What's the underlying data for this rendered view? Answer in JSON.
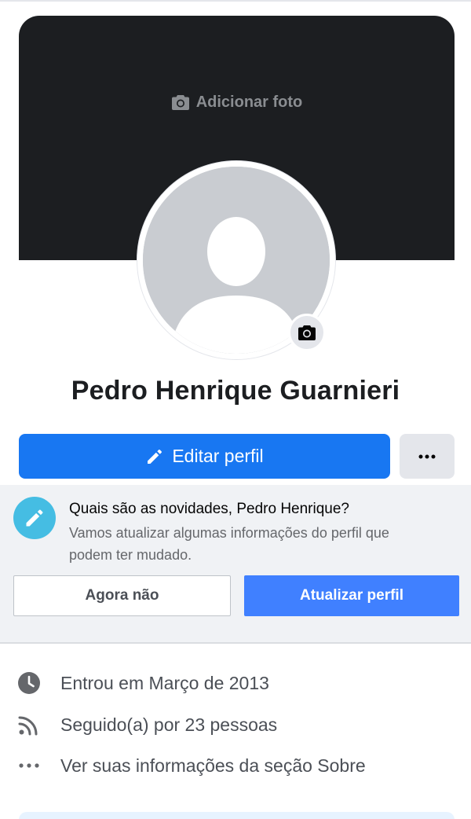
{
  "cover": {
    "add_photo_label": "Adicionar foto",
    "icons": [
      "camera-icon"
    ]
  },
  "profile": {
    "name": "Pedro Henrique Guarnieri"
  },
  "actions": {
    "edit_label": "Editar perfil",
    "edit_icon": "pencil-icon",
    "more_icon": "more-horizontal-icon"
  },
  "update_prompt": {
    "title": "Quais são as novidades, Pedro Henrique?",
    "description": "Vamos atualizar algumas informações do perfil que podem ter mudado.",
    "later_label": "Agora não",
    "update_label": "Atualizar perfil",
    "icon": "pencil-icon"
  },
  "intro": {
    "items": [
      {
        "icon": "clock-icon",
        "text": "Entrou em Março de 2013"
      },
      {
        "icon": "rss-feed-icon",
        "text": "Seguido(a) por 23 pessoas"
      },
      {
        "icon": "more-horizontal-icon",
        "text": "Ver suas informações da seção Sobre"
      }
    ]
  },
  "colors": {
    "primary": "#1877f2",
    "update_button": "#4080ff",
    "cover_bg": "#1c1e21",
    "panel_bg": "#f0f2f5",
    "pencil_badge": "#45bde3"
  }
}
